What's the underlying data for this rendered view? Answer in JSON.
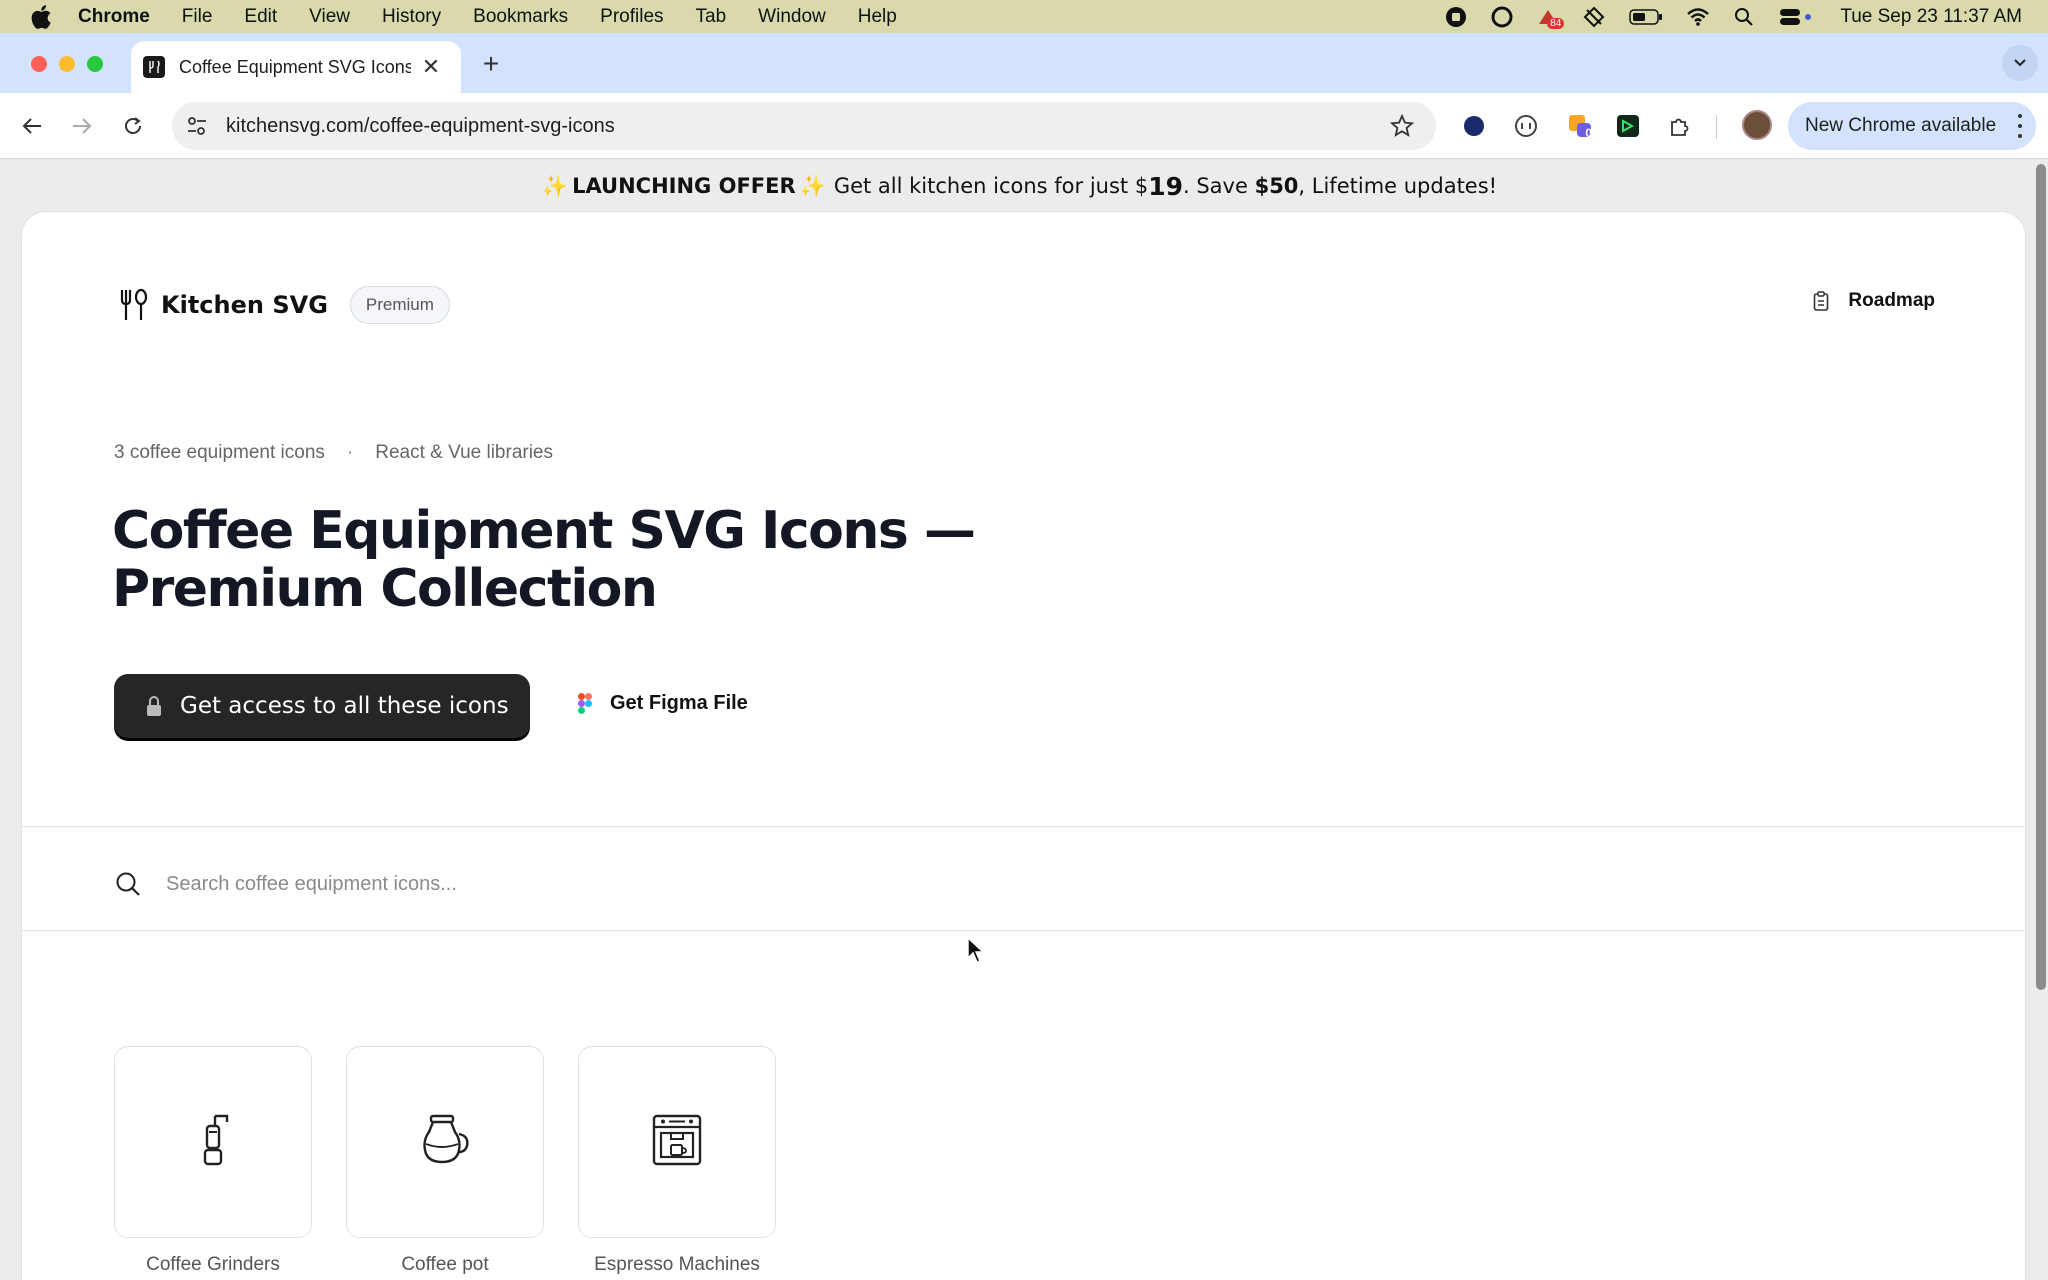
{
  "menubar": {
    "app_name": "Chrome",
    "items": [
      "File",
      "Edit",
      "View",
      "History",
      "Bookmarks",
      "Profiles",
      "Tab",
      "Window",
      "Help"
    ],
    "status_badge": "84",
    "clock": "Tue Sep 23  11:37 AM"
  },
  "browser": {
    "tab_title": "Coffee Equipment SVG Icons",
    "url": "kitchensvg.com/coffee-equipment-svg-icons",
    "extension_badge": "0",
    "update_label": "New Chrome available"
  },
  "banner": {
    "spark": "✨",
    "offer_label": "LAUNCHING OFFER",
    "text_1": "Get all kitchen icons for just $",
    "price": "19",
    "text_2": ". Save ",
    "savings": "$50",
    "text_3": ", Lifetime updates!"
  },
  "header": {
    "brand": "Kitchen SVG",
    "badge": "Premium",
    "roadmap_label": "Roadmap"
  },
  "hero": {
    "count_text": "3 coffee equipment icons",
    "separator": "·",
    "libraries_text": "React & Vue libraries",
    "title_line_1": "Coffee Equipment SVG Icons —",
    "title_line_2": "Premium Collection",
    "cta_label": "Get access to all these icons",
    "figma_label": "Get Figma File"
  },
  "search": {
    "placeholder": "Search coffee equipment icons..."
  },
  "icons": [
    {
      "label": "Coffee Grinders",
      "icon": "coffee-grinder-icon"
    },
    {
      "label": "Coffee pot",
      "icon": "coffee-pot-icon"
    },
    {
      "label": "Espresso Machines",
      "icon": "espresso-machine-icon"
    }
  ],
  "colors": {
    "menubar_bg": "#d9d9ac",
    "tabstrip_bg": "#d3e3fd",
    "cta_bg": "#262626",
    "title_color": "#141824"
  }
}
